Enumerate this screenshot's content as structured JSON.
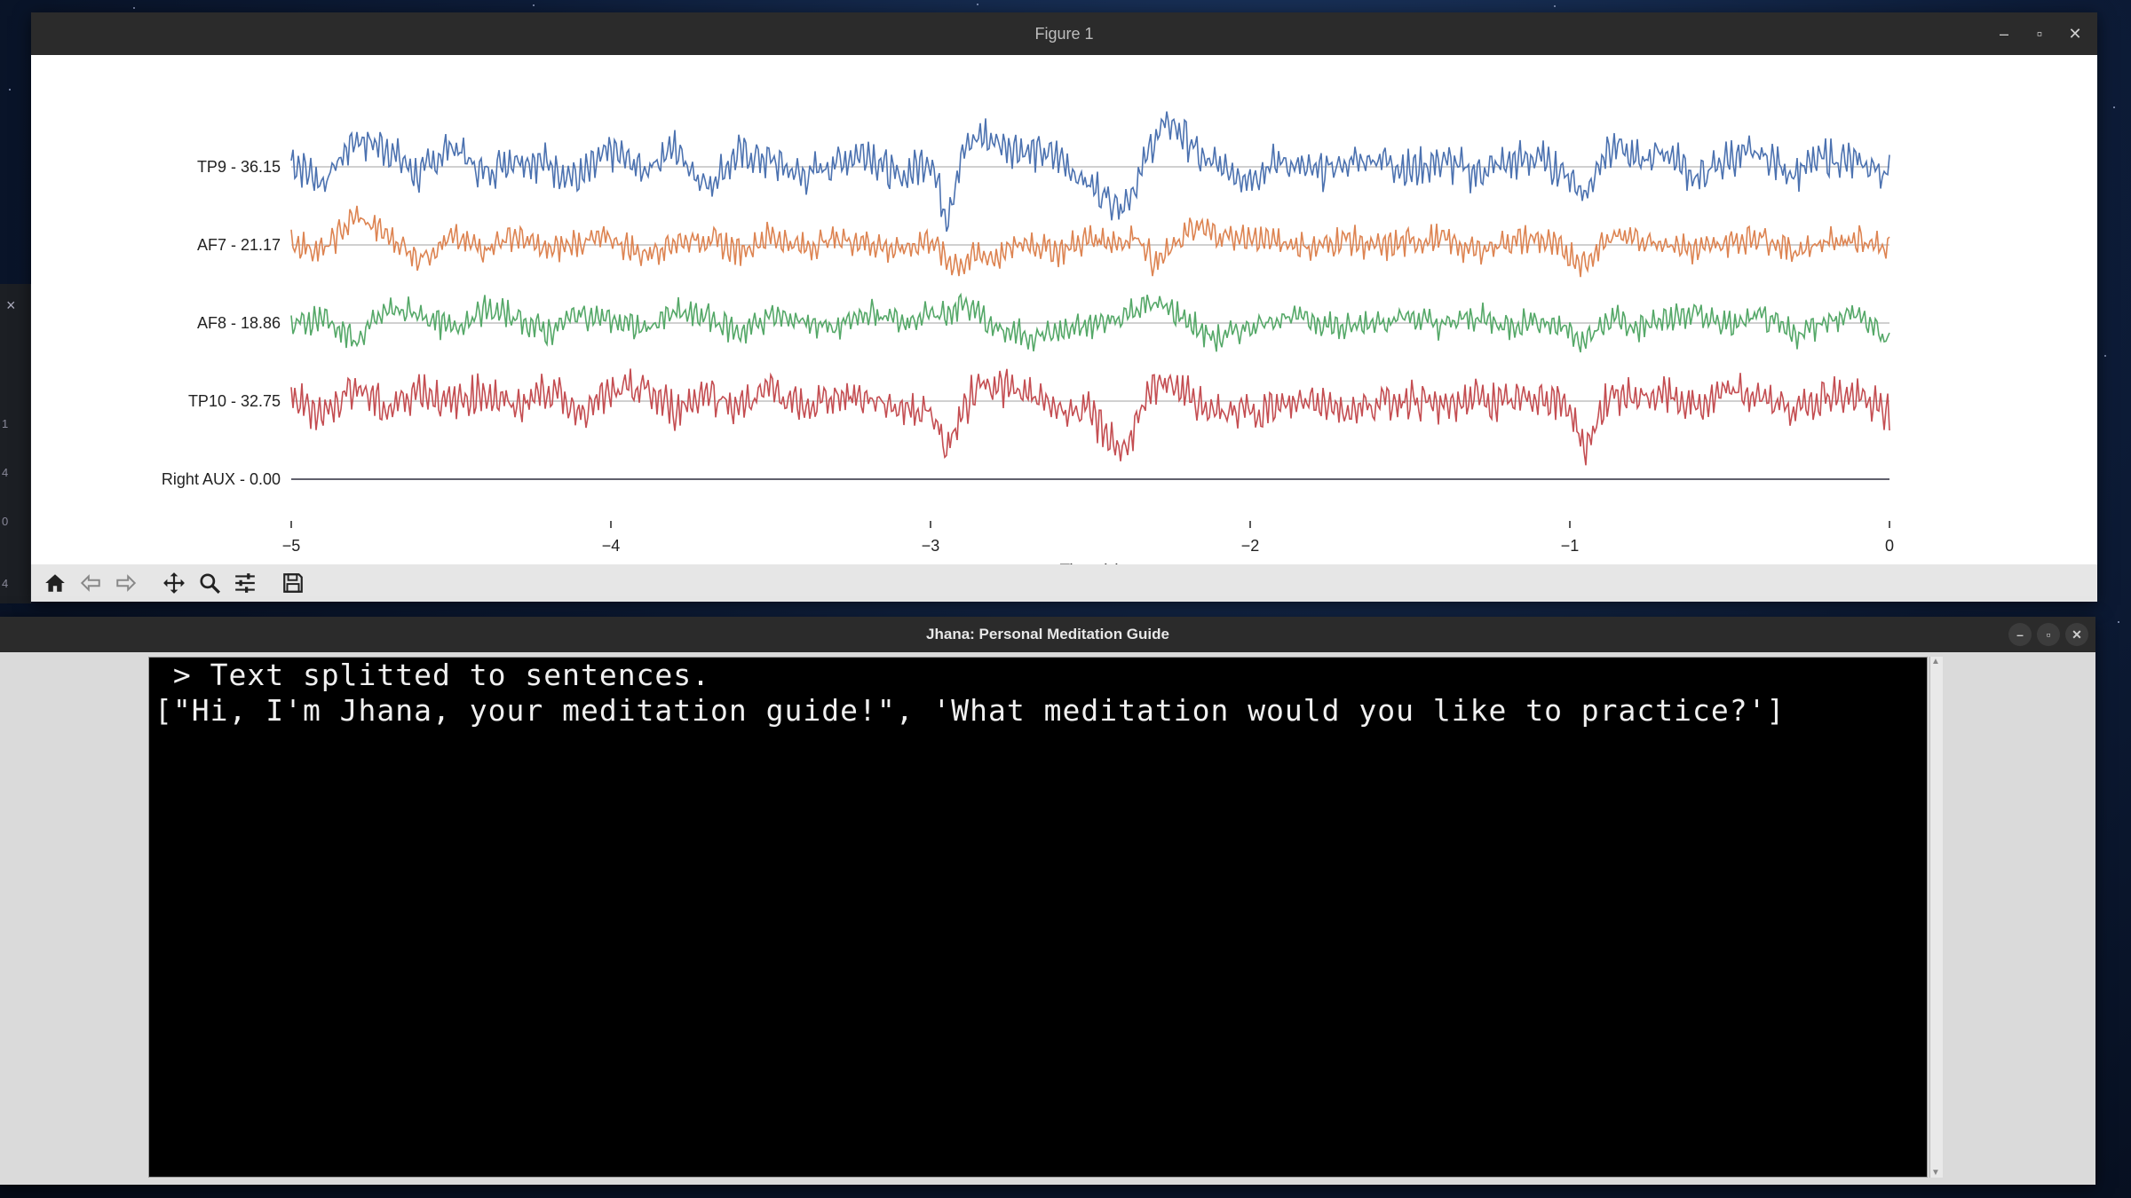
{
  "figure_window": {
    "title": "Figure 1",
    "toolbar": [
      "home-icon",
      "back-arrow-icon",
      "forward-arrow-icon",
      "pan-icon",
      "zoom-icon",
      "configure-subplots-icon",
      "save-icon"
    ]
  },
  "terminal_window": {
    "title": "Jhana: Personal Meditation Guide",
    "lines": [
      " > Text splitted to sentences.",
      "[\"Hi, I'm Jhana, your meditation guide!\", 'What meditation would you like to practice?']"
    ]
  },
  "chart_data": {
    "type": "line",
    "xlabel": "Time (s)",
    "xlim": [
      -5,
      0
    ],
    "xticks": [
      "−5",
      "−4",
      "−3",
      "−2",
      "−1",
      "0"
    ],
    "ytick_labels": [
      "TP9 - 36.15",
      "AF7 - 21.17",
      "AF8 - 18.86",
      "TP10 - 32.75",
      "Right AUX - 0.00"
    ],
    "grid": true,
    "series": [
      {
        "name": "TP9 - 36.15",
        "color": "#4c72b0",
        "x": [
          -5,
          -4.9,
          -4.8,
          -4.7,
          -4.6,
          -4.5,
          -4.4,
          -4.3,
          -4.2,
          -4.1,
          -4,
          -3.9,
          -3.8,
          -3.7,
          -3.6,
          -3.5,
          -3.4,
          -3.3,
          -3.2,
          -3.1,
          -3,
          -2.95,
          -2.9,
          -2.85,
          -2.8,
          -2.7,
          -2.6,
          -2.5,
          -2.4,
          -2.35,
          -2.3,
          -2.25,
          -2.2,
          -2.15,
          -2.1,
          -2,
          -1.9,
          -1.8,
          -1.7,
          -1.6,
          -1.5,
          -1.4,
          -1.3,
          -1.2,
          -1.1,
          -1,
          -0.95,
          -0.9,
          -0.85,
          -0.8,
          -0.7,
          -0.6,
          -0.5,
          -0.4,
          -0.3,
          -0.2,
          -0.1,
          0
        ],
        "y": [
          0.2,
          -0.5,
          0.9,
          0.6,
          -0.3,
          0.7,
          -0.2,
          0.3,
          0.1,
          -0.4,
          0.5,
          -0.1,
          0.6,
          -0.6,
          0.4,
          0.2,
          -0.3,
          0.1,
          0.5,
          -0.4,
          0.3,
          -1.6,
          0.4,
          1.0,
          0.8,
          0.5,
          0.3,
          -0.6,
          -1.2,
          -0.4,
          0.9,
          1.4,
          0.9,
          0.2,
          0,
          -0.3,
          0.2,
          -0.2,
          0.1,
          0.3,
          -0.1,
          0.2,
          -0.2,
          0.1,
          0.3,
          -0.3,
          -0.9,
          0.4,
          0.6,
          0.2,
          0.5,
          -0.4,
          0.3,
          0.4,
          -0.2,
          0.3,
          0.1,
          -0.2
        ]
      },
      {
        "name": "AF7 - 21.17",
        "color": "#dd8452",
        "x": [
          -5,
          -4.9,
          -4.8,
          -4.7,
          -4.6,
          -4.5,
          -4.4,
          -4.3,
          -4.2,
          -4.1,
          -4,
          -3.9,
          -3.8,
          -3.7,
          -3.6,
          -3.5,
          -3.4,
          -3.3,
          -3.2,
          -3.1,
          -3,
          -2.95,
          -2.9,
          -2.85,
          -2.8,
          -2.7,
          -2.6,
          -2.5,
          -2.4,
          -2.35,
          -2.3,
          -2.25,
          -2.2,
          -2.15,
          -2.1,
          -2,
          -1.9,
          -1.8,
          -1.7,
          -1.6,
          -1.5,
          -1.4,
          -1.3,
          -1.2,
          -1.1,
          -1,
          -0.95,
          -0.9,
          -0.85,
          -0.8,
          -0.7,
          -0.6,
          -0.5,
          -0.4,
          -0.3,
          -0.2,
          -0.1,
          0
        ],
        "y": [
          0.1,
          -0.2,
          0.9,
          0.3,
          -0.4,
          0.2,
          -0.1,
          0.3,
          -0.2,
          0.1,
          0.2,
          -0.3,
          0.1,
          0.2,
          -0.2,
          0.3,
          -0.1,
          0.2,
          0.1,
          -0.2,
          0.2,
          -0.5,
          -0.6,
          -0.3,
          -0.4,
          0.1,
          -0.2,
          0.2,
          0.1,
          0.3,
          -0.6,
          -0.2,
          0.4,
          0.5,
          0.3,
          0.2,
          0.1,
          -0.1,
          0.2,
          -0.1,
          0.1,
          0.2,
          -0.2,
          0.1,
          0.2,
          -0.3,
          -0.6,
          0.1,
          0.3,
          0.2,
          0.1,
          -0.2,
          0.1,
          0.3,
          -0.2,
          0.1,
          0.2,
          -0.1
        ]
      },
      {
        "name": "AF8 - 18.86",
        "color": "#55a868",
        "x": [
          -5,
          -4.9,
          -4.8,
          -4.7,
          -4.6,
          -4.5,
          -4.4,
          -4.3,
          -4.2,
          -4.1,
          -4,
          -3.9,
          -3.8,
          -3.7,
          -3.6,
          -3.5,
          -3.4,
          -3.3,
          -3.2,
          -3.1,
          -3,
          -2.95,
          -2.9,
          -2.85,
          -2.8,
          -2.7,
          -2.6,
          -2.5,
          -2.4,
          -2.35,
          -2.3,
          -2.25,
          -2.2,
          -2.15,
          -2.1,
          -2,
          -1.9,
          -1.8,
          -1.7,
          -1.6,
          -1.5,
          -1.4,
          -1.3,
          -1.2,
          -1.1,
          -1,
          -0.95,
          -0.9,
          -0.85,
          -0.8,
          -0.7,
          -0.6,
          -0.5,
          -0.4,
          -0.3,
          -0.2,
          -0.1,
          0
        ],
        "y": [
          -0.1,
          0.2,
          -0.6,
          0.4,
          0.3,
          -0.2,
          0.4,
          0.2,
          -0.3,
          0.3,
          0.1,
          -0.2,
          0.3,
          0.2,
          -0.3,
          0.2,
          0.1,
          -0.2,
          0.3,
          0.1,
          0.2,
          0.3,
          0.6,
          0.3,
          -0.2,
          -0.4,
          -0.3,
          -0.1,
          0.2,
          0.5,
          0.6,
          0.4,
          0.1,
          -0.3,
          -0.5,
          -0.1,
          0.2,
          0.1,
          -0.2,
          0.1,
          0.2,
          -0.1,
          0.2,
          -0.1,
          0.1,
          -0.2,
          -0.6,
          -0.1,
          0.2,
          -0.2,
          0.1,
          0.3,
          -0.1,
          0.2,
          -0.4,
          0.1,
          0.3,
          -0.6
        ]
      },
      {
        "name": "TP10 - 32.75",
        "color": "#c44e52",
        "x": [
          -5,
          -4.9,
          -4.8,
          -4.7,
          -4.6,
          -4.5,
          -4.4,
          -4.3,
          -4.2,
          -4.1,
          -4,
          -3.9,
          -3.8,
          -3.7,
          -3.6,
          -3.5,
          -3.4,
          -3.3,
          -3.2,
          -3.1,
          -3,
          -2.95,
          -2.9,
          -2.85,
          -2.8,
          -2.7,
          -2.6,
          -2.5,
          -2.4,
          -2.35,
          -2.3,
          -2.25,
          -2.2,
          -2.15,
          -2.1,
          -2,
          -1.9,
          -1.8,
          -1.7,
          -1.6,
          -1.5,
          -1.4,
          -1.3,
          -1.2,
          -1.1,
          -1,
          -0.95,
          -0.9,
          -0.85,
          -0.8,
          -0.7,
          -0.6,
          -0.5,
          -0.4,
          -0.3,
          -0.2,
          -0.1,
          0
        ],
        "y": [
          0.1,
          -0.4,
          0.5,
          -0.3,
          0.4,
          -0.1,
          0.3,
          -0.2,
          0.4,
          -0.3,
          0.2,
          0.4,
          -0.3,
          0.3,
          -0.2,
          0.4,
          -0.3,
          0.2,
          0.1,
          -0.2,
          -0.3,
          -1.5,
          -0.4,
          0.6,
          0.5,
          0.2,
          -0.2,
          -0.4,
          -1.6,
          -0.6,
          0.4,
          0.7,
          0.2,
          -0.2,
          -0.4,
          -0.3,
          -0.2,
          0.1,
          -0.3,
          -0.1,
          0.1,
          -0.2,
          0.1,
          -0.1,
          0.2,
          -0.2,
          -1.6,
          -0.2,
          0.2,
          0.1,
          0.2,
          -0.2,
          0.3,
          0.1,
          -0.3,
          0.2,
          0.1,
          -0.4
        ]
      },
      {
        "name": "Right AUX - 0.00",
        "color": "#8172b2",
        "x": [
          -5,
          0
        ],
        "y": [
          0,
          0
        ]
      }
    ]
  }
}
